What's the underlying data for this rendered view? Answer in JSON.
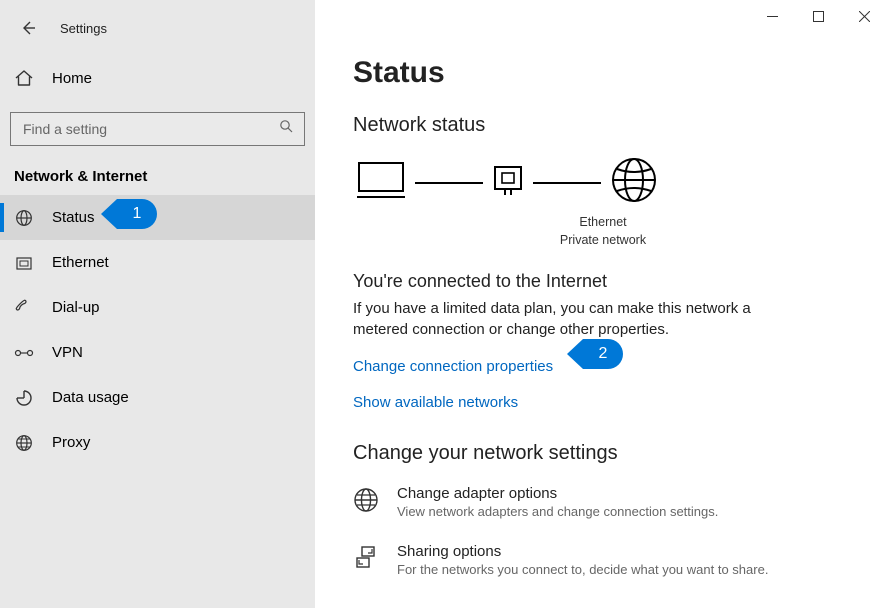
{
  "window": {
    "title": "Settings"
  },
  "home_label": "Home",
  "search": {
    "placeholder": "Find a setting"
  },
  "section_header": "Network & Internet",
  "nav": [
    {
      "label": "Status"
    },
    {
      "label": "Ethernet"
    },
    {
      "label": "Dial-up"
    },
    {
      "label": "VPN"
    },
    {
      "label": "Data usage"
    },
    {
      "label": "Proxy"
    }
  ],
  "page": {
    "title": "Status",
    "subtitle": "Network status",
    "diagram_caption_line1": "Ethernet",
    "diagram_caption_line2": "Private network",
    "connected_title": "You're connected to the Internet",
    "connected_body": "If you have a limited data plan, you can make this network a metered connection or change other properties.",
    "link_change": "Change connection properties",
    "link_show": "Show available networks",
    "settings_header": "Change your network settings",
    "opt1_title": "Change adapter options",
    "opt1_desc": "View network adapters and change connection settings.",
    "opt2_title": "Sharing options",
    "opt2_desc": "For the networks you connect to, decide what you want to share."
  },
  "callouts": {
    "one": "1",
    "two": "2"
  }
}
